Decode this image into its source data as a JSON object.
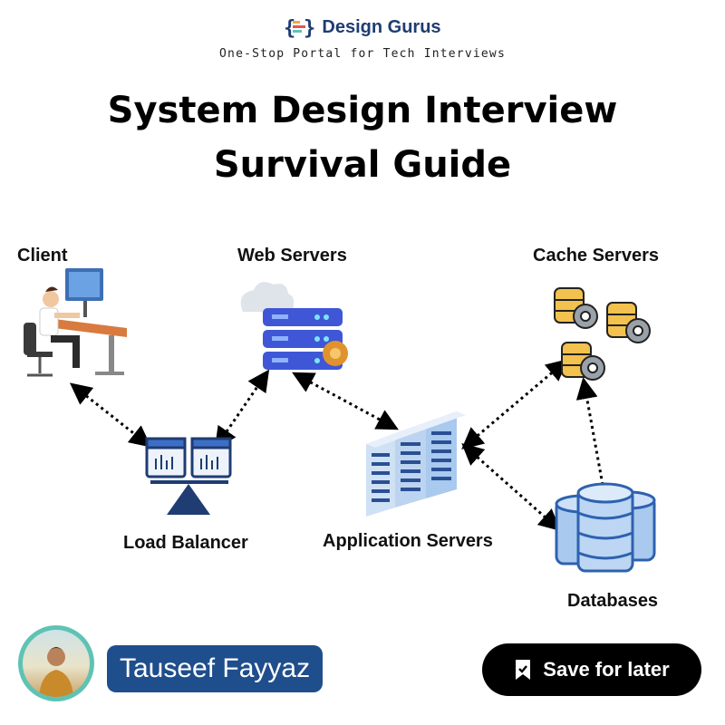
{
  "brand": {
    "name": "Design Gurus",
    "tagline": "One-Stop Portal for Tech Interviews"
  },
  "title": {
    "line1": "System Design Interview",
    "line2": "Survival Guide"
  },
  "nodes": {
    "client": "Client",
    "web_servers": "Web Servers",
    "cache_servers": "Cache Servers",
    "load_balancer": "Load Balancer",
    "application_servers": "Application Servers",
    "databases": "Databases"
  },
  "footer": {
    "author": "Tauseef Fayyaz",
    "save_label": "Save for later"
  },
  "colors": {
    "brand_blue": "#1f4e8c",
    "accent_teal": "#5fc3b3",
    "gold": "#f2c14e",
    "db_blue": "#a9c9ee"
  }
}
